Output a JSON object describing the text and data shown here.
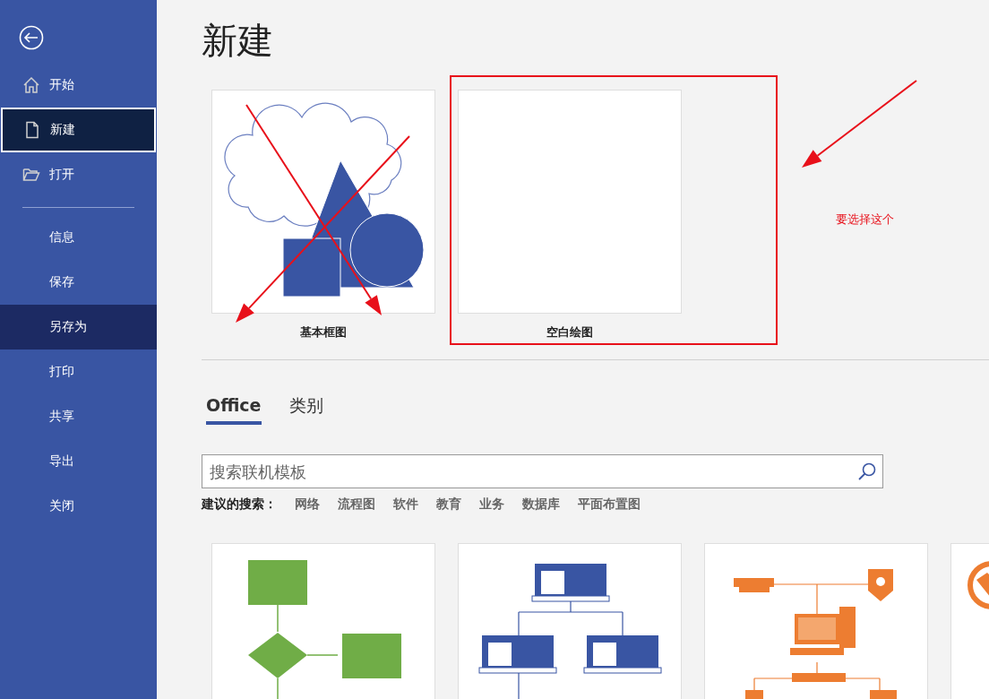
{
  "sidebar": {
    "primary": [
      {
        "label": "开始",
        "selected": false,
        "hovered": false
      },
      {
        "label": "新建",
        "selected": true,
        "hovered": false
      },
      {
        "label": "打开",
        "selected": false,
        "hovered": false
      }
    ],
    "secondary": [
      {
        "label": "信息",
        "selected": false,
        "hovered": false
      },
      {
        "label": "保存",
        "selected": false,
        "hovered": false
      },
      {
        "label": "另存为",
        "selected": false,
        "hovered": true
      },
      {
        "label": "打印",
        "selected": false,
        "hovered": false
      },
      {
        "label": "共享",
        "selected": false,
        "hovered": false
      },
      {
        "label": "导出",
        "selected": false,
        "hovered": false
      },
      {
        "label": "关闭",
        "selected": false,
        "hovered": false
      }
    ]
  },
  "heading": "新建",
  "featured_templates": [
    {
      "label": "基本框图",
      "kind": "basic",
      "crossed_out": true
    },
    {
      "label": "空白绘图",
      "kind": "blank",
      "crossed_out": false
    }
  ],
  "annotation": {
    "note": "要选择这个"
  },
  "tabs": [
    {
      "label": "Office",
      "selected": true
    },
    {
      "label": "类别",
      "selected": false
    }
  ],
  "search": {
    "placeholder": "搜索联机模板"
  },
  "suggested_searches": {
    "label": "建议的搜索：",
    "terms": [
      "网络",
      "流程图",
      "软件",
      "教育",
      "业务",
      "数据库",
      "平面布置图"
    ]
  },
  "templates": [
    {
      "kind": "flowchart"
    },
    {
      "kind": "org"
    },
    {
      "kind": "network"
    },
    {
      "kind": "globe"
    }
  ]
}
